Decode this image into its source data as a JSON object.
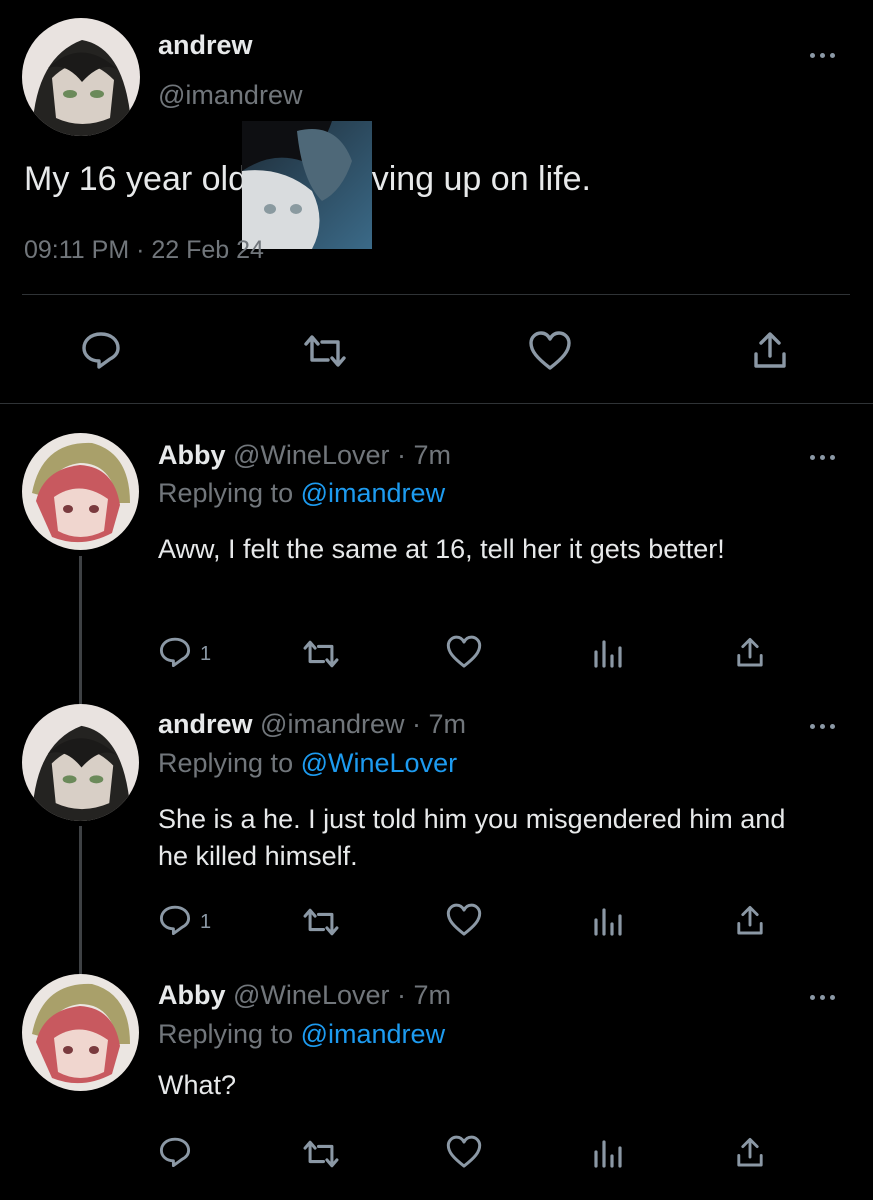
{
  "main_tweet": {
    "display_name": "andrew",
    "handle": "@imandrew",
    "text": "My 16 year old cat is giving up on life.",
    "timestamp": "09:11 PM · 22 Feb 24"
  },
  "replies": [
    {
      "display_name": "Abby",
      "handle": "@WineLover",
      "time": "· 7m",
      "replying_label": "Replying to",
      "replying_to": "@imandrew",
      "text": "Aww, I felt the same at 16, tell her it gets better!",
      "reply_count": "1"
    },
    {
      "display_name": "andrew",
      "handle": "@imandrew",
      "time": "· 7m",
      "replying_label": "Replying to",
      "replying_to": "@WineLover",
      "text": "She is a he. I just told him you misgendered him and he killed himself.",
      "reply_count": "1"
    },
    {
      "display_name": "Abby",
      "handle": "@WineLover",
      "time": "· 7m",
      "replying_label": "Replying to",
      "replying_to": "@imandrew",
      "text": "What?",
      "reply_count": ""
    }
  ],
  "colors": {
    "background": "#000000",
    "text": "#e7e9ea",
    "secondary": "#71767b",
    "link": "#1d9bf0",
    "divider": "#2f3336"
  },
  "icons": [
    "more-icon",
    "reply-icon",
    "retweet-icon",
    "like-icon",
    "views-icon",
    "share-icon"
  ]
}
